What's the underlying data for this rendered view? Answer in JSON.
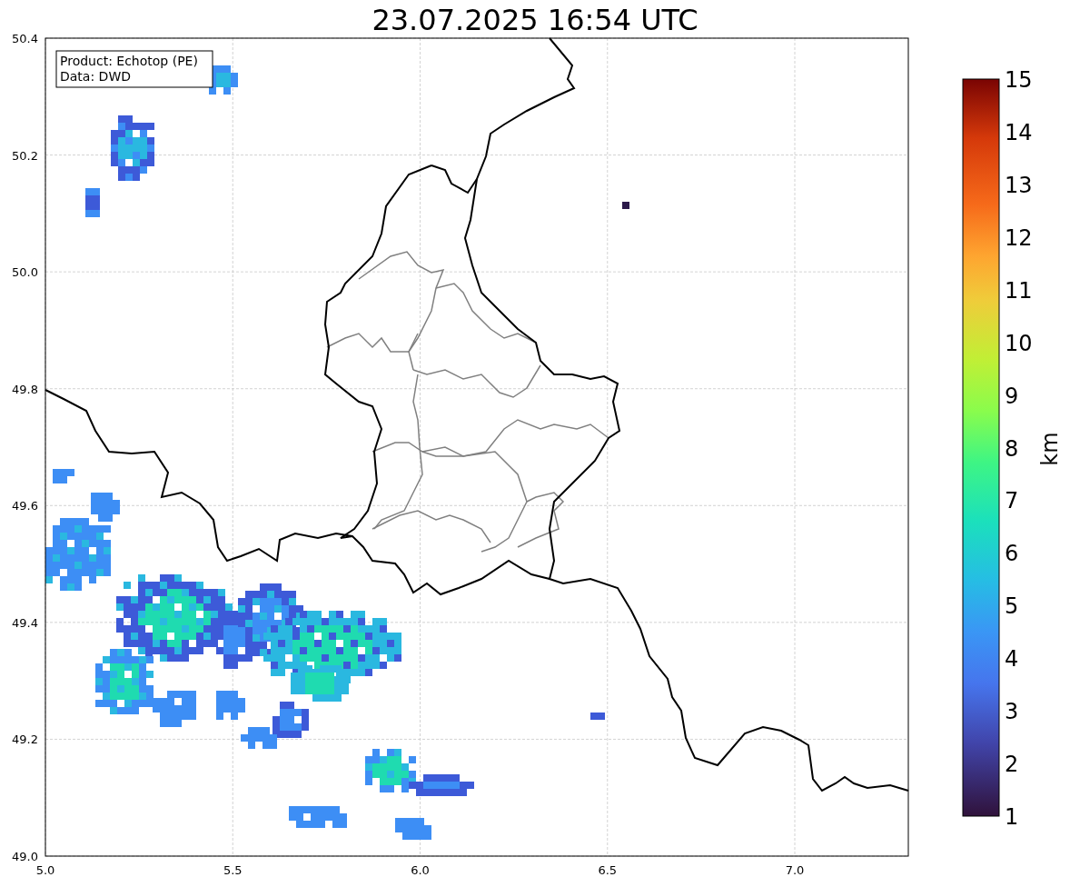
{
  "title": "23.07.2025 16:54 UTC",
  "legend": [
    "Product: Echotop (PE)",
    "Data: DWD"
  ],
  "x_axis": {
    "ticks": [
      "5.0",
      "5.5",
      "6.0",
      "6.5",
      "7.0"
    ]
  },
  "y_axis": {
    "ticks": [
      "50.4",
      "50.2",
      "50.0",
      "49.8",
      "49.6",
      "49.4",
      "49.2",
      "49.0"
    ]
  },
  "colorbar": {
    "label": "km",
    "ticks": [
      "15",
      "14",
      "13",
      "12",
      "11",
      "10",
      "9",
      "8",
      "7",
      "6",
      "5",
      "4",
      "3",
      "2",
      "1"
    ]
  }
}
